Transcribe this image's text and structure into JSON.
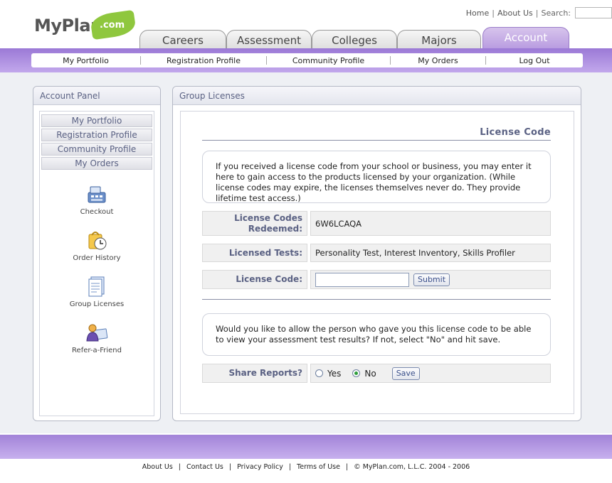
{
  "logo": {
    "text": "MyPlan",
    "suffix": ".com"
  },
  "toplinks": {
    "home": "Home",
    "about": "About Us",
    "search_label": "Search:"
  },
  "tabs": [
    {
      "label": "Careers"
    },
    {
      "label": "Assessment"
    },
    {
      "label": "Colleges"
    },
    {
      "label": "Majors"
    },
    {
      "label": "Account",
      "active": true
    }
  ],
  "subnav": [
    "My Portfolio",
    "Registration Profile",
    "Community Profile",
    "My Orders",
    "Log Out"
  ],
  "account_panel": {
    "title": "Account Panel",
    "buttons": [
      "My Portfolio",
      "Registration Profile",
      "Community Profile",
      "My Orders"
    ],
    "icons": [
      {
        "label": "Checkout",
        "icon": "cash-register-icon"
      },
      {
        "label": "Order History",
        "icon": "shopping-bag-clock-icon"
      },
      {
        "label": "Group Licenses",
        "icon": "license-document-icon"
      },
      {
        "label": "Refer-a-Friend",
        "icon": "person-card-icon"
      }
    ]
  },
  "group_licenses": {
    "title": "Group Licenses",
    "section_title": "License Code",
    "intro": "If you received a license code from your school or business, you may enter it here to gain access to the products licensed by your organization. (While license codes may expire, the licenses themselves never do. They provide lifetime test access.)",
    "redeemed_label": "License Codes Redeemed:",
    "redeemed_value": "6W6LCAQA",
    "tests_label": "Licensed Tests:",
    "tests_value": "Personality Test, Interest Inventory, Skills Profiler",
    "code_label": "License Code:",
    "code_value": "",
    "submit_label": "Submit",
    "share_text": "Would you like to allow the person who gave you this license code to be able to view your assessment test results? If not, select \"No\" and hit save.",
    "share_label": "Share Reports?",
    "yes_label": "Yes",
    "no_label": "No",
    "share_selected": "No",
    "save_label": "Save"
  },
  "footer": [
    "About Us",
    "Contact Us",
    "Privacy Policy",
    "Terms of Use",
    "© MyPlan.com, L.L.C. 2004 - 2006"
  ],
  "colors": {
    "brand_purple": "#b79ae0",
    "accent_text": "#5a6183",
    "leaf_green": "#8fc73e"
  }
}
